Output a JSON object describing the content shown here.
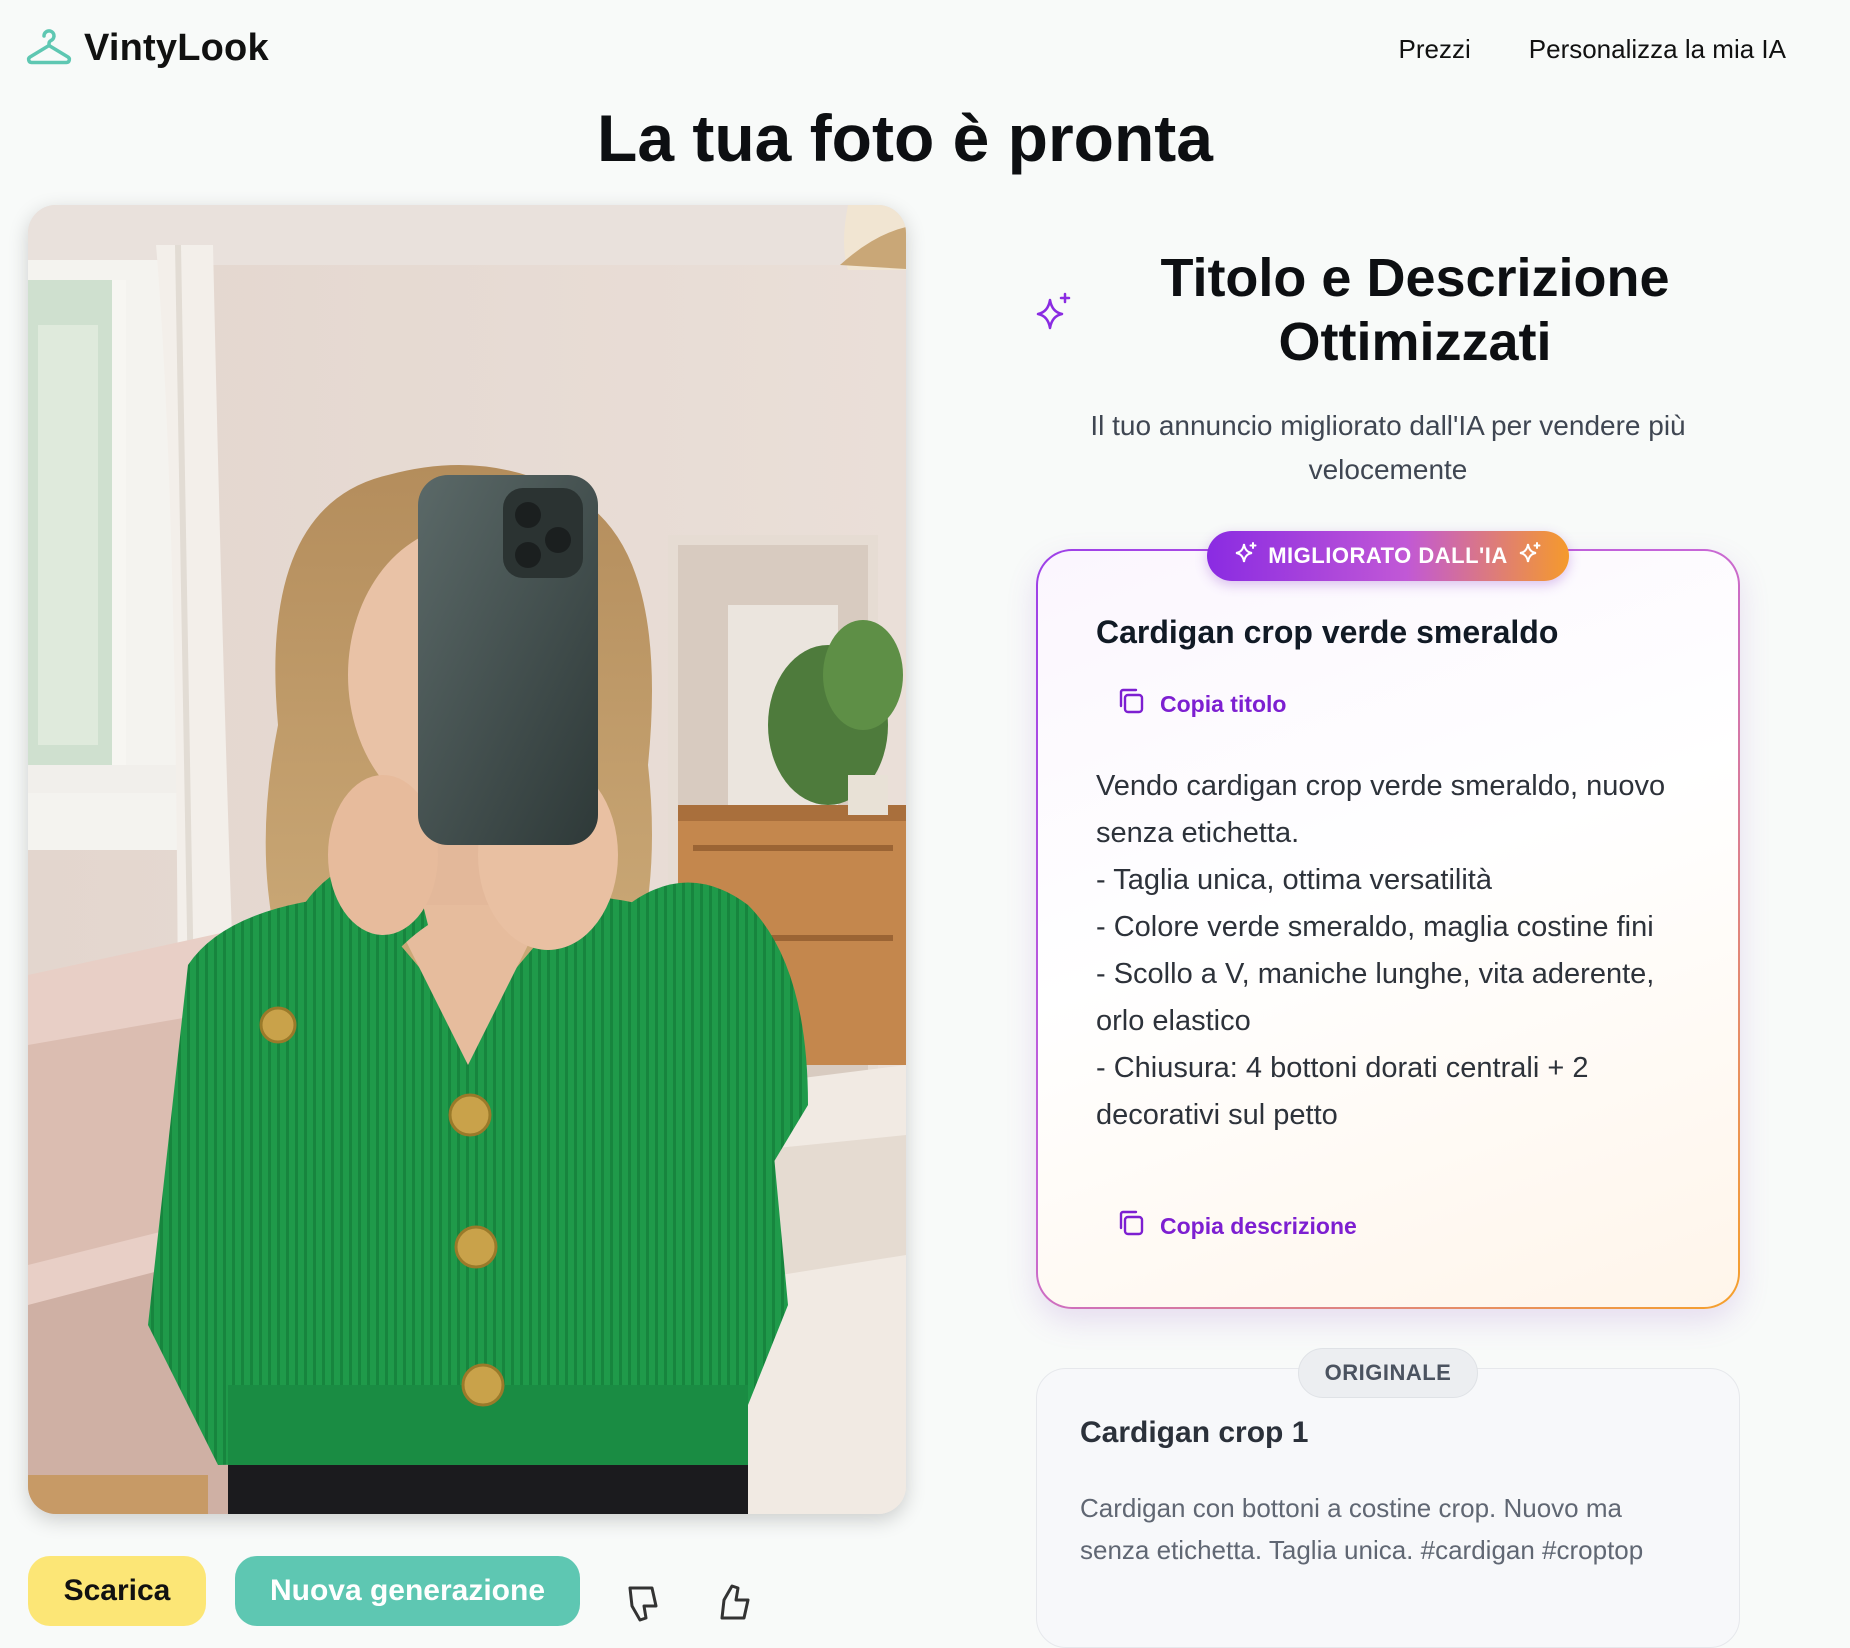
{
  "header": {
    "brand": "VintyLook",
    "nav": [
      {
        "label": "Prezzi"
      },
      {
        "label": "Personalizza la mia IA"
      }
    ]
  },
  "page_title": "La tua foto è pronta",
  "actions": {
    "download_label": "Scarica",
    "regenerate_label": "Nuova generazione"
  },
  "section": {
    "title": "Titolo e Descrizione Ottimizzati",
    "subtitle": "Il tuo annuncio migliorato dall'IA per vendere più velocemente"
  },
  "ai_listing": {
    "badge": "MIGLIORATO DALL'IA",
    "title": "Cardigan crop verde smeraldo",
    "copy_title_label": "Copia titolo",
    "description": "Vendo cardigan crop verde smeraldo, nuovo senza etichetta.\n- Taglia unica, ottima versatilità\n- Colore verde smeraldo, maglia costine fini\n- Scollo a V, maniche lunghe, vita aderente, orlo elastico\n- Chiusura: 4 bottoni dorati centrali + 2 decorativi sul petto",
    "copy_description_label": "Copia descrizione"
  },
  "original_listing": {
    "badge": "ORIGINALE",
    "title": "Cardigan crop 1",
    "description": "Cardigan con bottoni a costine crop. Nuovo ma senza etichetta. Taglia unica. #cardigan #croptop"
  },
  "colors": {
    "brand_teal": "#5ec7b2",
    "download_yellow": "#fce676",
    "ai_purple": "#8a2be2",
    "ai_orange": "#f59a2c",
    "cardigan_green": "#1f9a4a"
  }
}
